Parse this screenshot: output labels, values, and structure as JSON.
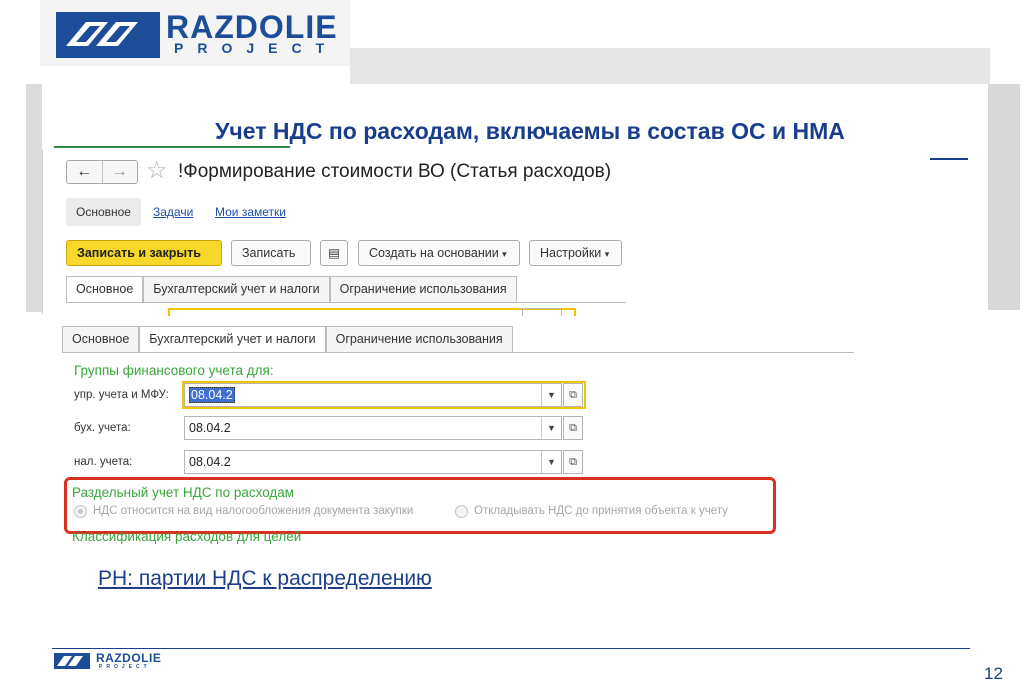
{
  "logo": {
    "word": "RAZDOLIE",
    "sub": "PROJECT"
  },
  "slide": {
    "title": "Учет НДС по расходам, включаемы в состав ОС и НМА",
    "link": "РН: партии НДС к распределению",
    "page_number": "12"
  },
  "colors": {
    "brand_blue": "#1d4d98",
    "accent_yellow": "#f6d72a",
    "highlight_red": "#d9301f",
    "group_green": "#3aa63c"
  },
  "form": {
    "nav_back_icon": "arrow-left-icon",
    "nav_forward_icon": "arrow-right-icon",
    "favorite_icon": "star-icon",
    "title": "!Формирование стоимости ВО (Статья расходов)",
    "top_tabs": {
      "main": "Основное",
      "tasks": "Задачи",
      "notes": "Мои заметки"
    },
    "toolbar": {
      "save_close": "Записать и закрыть",
      "save": "Записать",
      "list_icon": "document-list-icon",
      "create_based": "Создать на основании",
      "settings": "Настройки",
      "dropdown_arrow": "▾"
    },
    "tabs": [
      "Основное",
      "Бухгалтерский учет и налоги",
      "Ограничение использования"
    ]
  },
  "panel": {
    "tabs": [
      "Основное",
      "Бухгалтерский учет и налоги",
      "Ограничение использования"
    ],
    "group_title": "Группы финансового учета для:",
    "fields": [
      {
        "label": "упр. учета и МФУ:",
        "value": "08.04.2"
      },
      {
        "label": "бух. учета:",
        "value": "08.04.2"
      },
      {
        "label": "нал. учета:",
        "value": "08.04.2"
      }
    ],
    "separate_vat": {
      "title": "Раздельный учет НДС по расходам",
      "options": [
        {
          "label": "НДС относится на вид налогообложения документа закупки",
          "selected": true
        },
        {
          "label": "Откладывать НДС до принятия объекта к учету",
          "selected": false
        }
      ]
    },
    "classification_title": "Классификация расходов для целей"
  }
}
